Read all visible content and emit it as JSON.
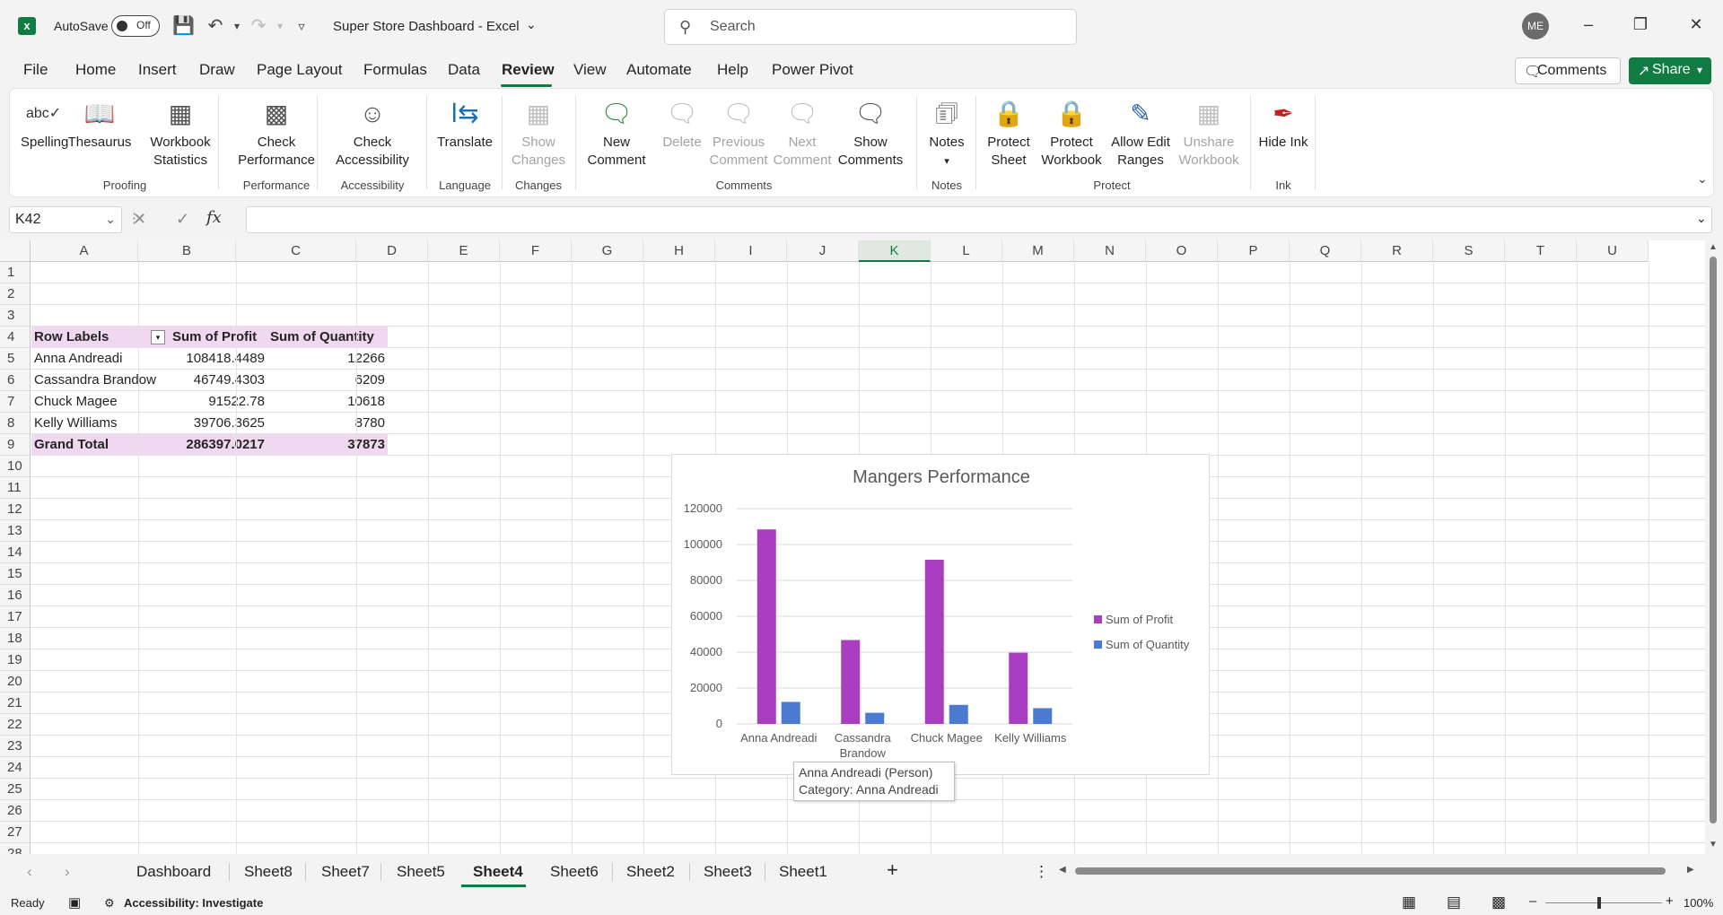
{
  "titlebar": {
    "autosave_label": "AutoSave",
    "toggle_state": "Off",
    "doc_title": "Super Store Dashboard  -  Excel",
    "search_placeholder": "Search",
    "avatar_initials": "ME"
  },
  "tabs": [
    "File",
    "Home",
    "Insert",
    "Draw",
    "Page Layout",
    "Formulas",
    "Data",
    "Review",
    "View",
    "Automate",
    "Help",
    "Power Pivot"
  ],
  "active_tab": "Review",
  "header_buttons": {
    "comments": "Comments",
    "share": "Share"
  },
  "ribbon": {
    "spelling": "Spelling",
    "thesaurus": "Thesaurus",
    "workbook_statistics": "Workbook Statistics",
    "check_performance": "Check Performance",
    "check_accessibility": "Check Accessibility",
    "translate": "Translate",
    "show_changes": "Show Changes",
    "new_comment": "New Comment",
    "delete": "Delete",
    "previous_comment": "Previous Comment",
    "next_comment": "Next Comment",
    "show_comments": "Show Comments",
    "notes": "Notes",
    "protect_sheet": "Protect Sheet",
    "protect_workbook": "Protect Workbook",
    "allow_edit_ranges": "Allow Edit Ranges",
    "unshare_workbook": "Unshare Workbook",
    "hide_ink": "Hide Ink",
    "groups": {
      "proofing": "Proofing",
      "performance": "Performance",
      "accessibility": "Accessibility",
      "language": "Language",
      "changes": "Changes",
      "comments": "Comments",
      "notes": "Notes",
      "protect": "Protect",
      "ink": "Ink"
    }
  },
  "formula_bar": {
    "name_box": "K42",
    "formula": ""
  },
  "columns": [
    "A",
    "B",
    "C",
    "D",
    "E",
    "F",
    "G",
    "H",
    "I",
    "J",
    "K",
    "L",
    "M",
    "N",
    "O",
    "P",
    "Q",
    "R",
    "S",
    "T",
    "U"
  ],
  "selected_column": "K",
  "rows": [
    "1",
    "2",
    "3",
    "4",
    "5",
    "6",
    "7",
    "8",
    "9",
    "10",
    "11",
    "12",
    "13",
    "14",
    "15",
    "16",
    "17",
    "18",
    "19",
    "20",
    "21",
    "22",
    "23",
    "24",
    "25",
    "26",
    "27",
    "28"
  ],
  "pivot": {
    "headers": [
      "Row Labels",
      "Sum of Profit",
      "Sum of Quantity"
    ],
    "rows": [
      [
        "Anna Andreadi",
        "108418.4489",
        "12266"
      ],
      [
        "Cassandra Brandow",
        "46749.4303",
        "6209"
      ],
      [
        "Chuck Magee",
        "91522.78",
        "10618"
      ],
      [
        "Kelly Williams",
        "39706.3625",
        "8780"
      ]
    ],
    "total": [
      "Grand Total",
      "286397.0217",
      "37873"
    ]
  },
  "chart_data": {
    "type": "bar",
    "title": "Mangers Performance",
    "categories": [
      "Anna Andreadi",
      "Cassandra Brandow",
      "Chuck Magee",
      "Kelly Williams"
    ],
    "series": [
      {
        "name": "Sum of Profit",
        "values": [
          108418.4489,
          46749.4303,
          91522.78,
          39706.3625
        ],
        "color": "#a93fc0"
      },
      {
        "name": "Sum of Quantity",
        "values": [
          12266,
          6209,
          10618,
          8780
        ],
        "color": "#4a7bd0"
      }
    ],
    "yticks": [
      "0",
      "20000",
      "40000",
      "60000",
      "80000",
      "100000",
      "120000"
    ],
    "ylim": [
      0,
      120000
    ],
    "legend": "right",
    "grid": true
  },
  "tooltip": {
    "line1": "Anna Andreadi (Person)",
    "line2": "Category: Anna Andreadi"
  },
  "sheets": [
    "Dashboard",
    "Sheet8",
    "Sheet7",
    "Sheet5",
    "Sheet4",
    "Sheet6",
    "Sheet2",
    "Sheet3",
    "Sheet1"
  ],
  "active_sheet": "Sheet4",
  "status": {
    "ready": "Ready",
    "accessibility": "Accessibility: Investigate",
    "zoom": "100%"
  }
}
